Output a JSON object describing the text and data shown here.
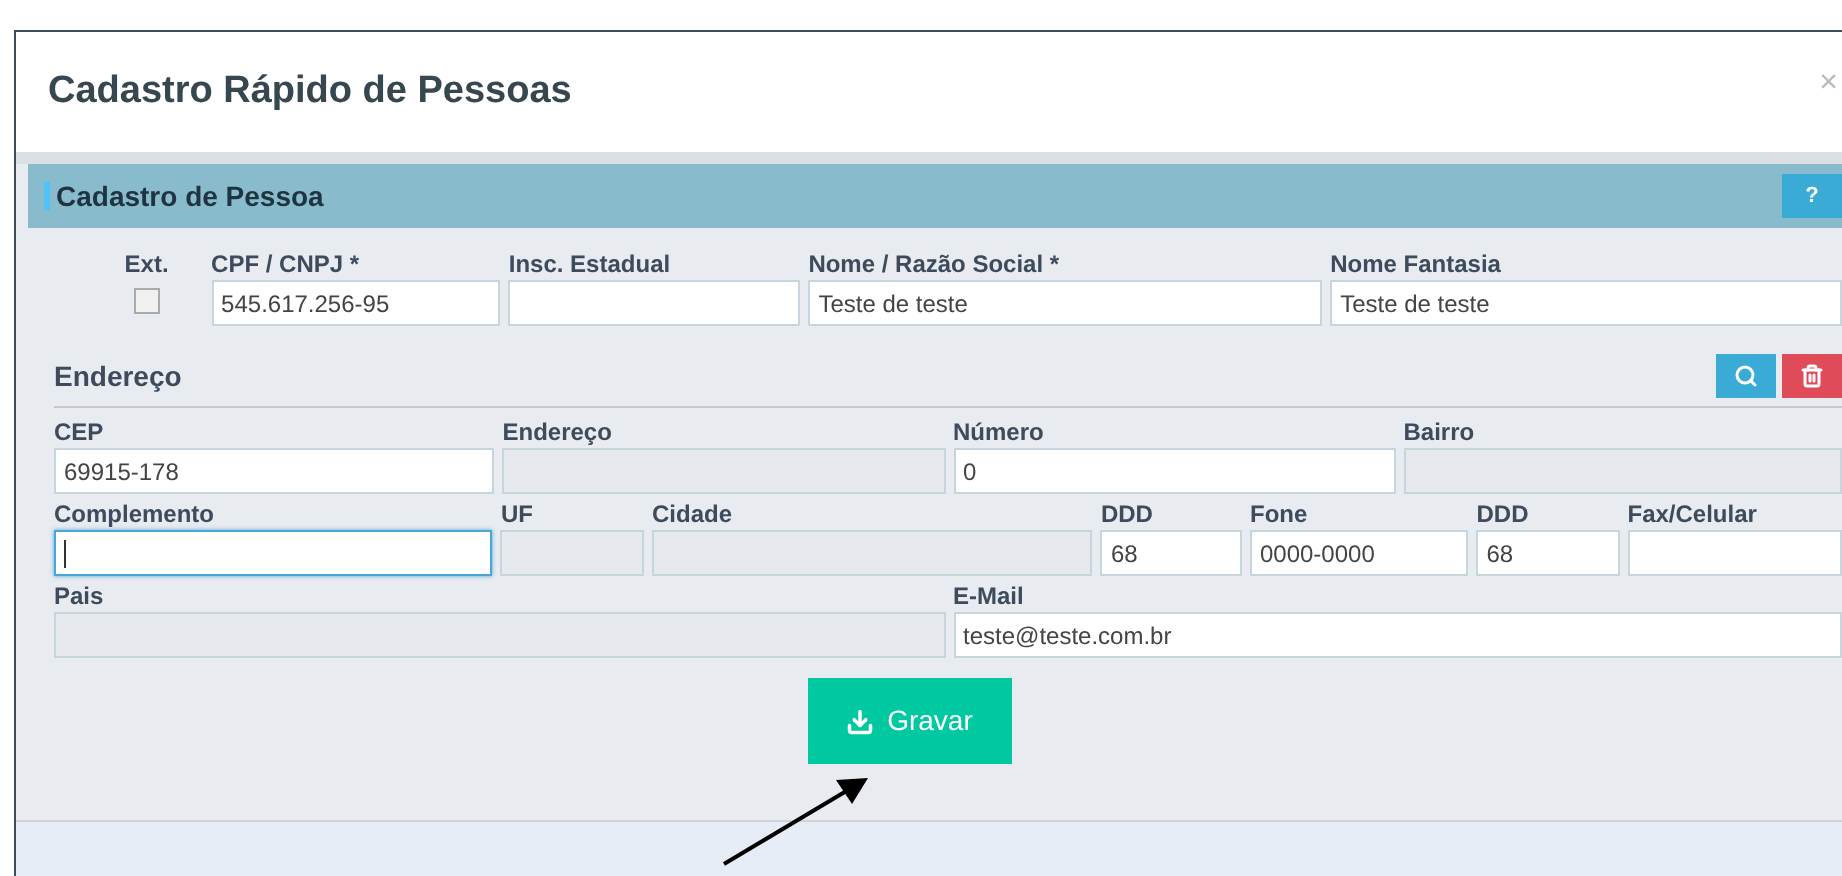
{
  "modal": {
    "title": "Cadastro Rápido de Pessoas",
    "close": "×"
  },
  "panel": {
    "title": "Cadastro de Pessoa",
    "help": "?"
  },
  "ext": {
    "label": "Ext.",
    "checked": false
  },
  "person_fields": [
    {
      "label": "CPF / CNPJ *",
      "value": "545.617.256-95",
      "disabled": false,
      "focused": false
    },
    {
      "label": "Insc. Estadual",
      "disabled": false,
      "focused": false
    },
    {
      "label": "Nome / Razão Social *",
      "value": "Teste de teste",
      "disabled": false,
      "focused": false
    },
    {
      "label": "Nome Fantasia",
      "value": "Teste de teste",
      "disabled": false,
      "focused": false
    }
  ],
  "address": {
    "title": "Endereço",
    "rows": [
      [
        {
          "label": "CEP",
          "value": "69915-178",
          "disabled": false,
          "focused": false
        },
        {
          "label": "Endereço",
          "disabled": true,
          "focused": false
        },
        {
          "label": "Número",
          "value": "0",
          "disabled": false,
          "focused": false
        },
        {
          "label": "Bairro",
          "disabled": true,
          "focused": false
        }
      ],
      [
        {
          "label": "Complemento",
          "disabled": false,
          "focused": true
        },
        {
          "label": "UF",
          "disabled": true,
          "focused": false
        },
        {
          "label": "Cidade",
          "disabled": true,
          "focused": false
        },
        {
          "label": "DDD",
          "value": "68",
          "disabled": false,
          "focused": false
        },
        {
          "label": "Fone",
          "value": "0000-0000",
          "disabled": false,
          "focused": false
        },
        {
          "label": "DDD",
          "value": "68",
          "disabled": false,
          "focused": false
        },
        {
          "label": "Fax/Celular",
          "disabled": false,
          "focused": false
        }
      ],
      [
        {
          "label": "Pais",
          "disabled": true,
          "focused": false
        },
        {
          "label": "E-Mail",
          "value": "teste@teste.com.br",
          "disabled": false,
          "focused": false
        }
      ]
    ]
  },
  "save_button": "Gravar"
}
